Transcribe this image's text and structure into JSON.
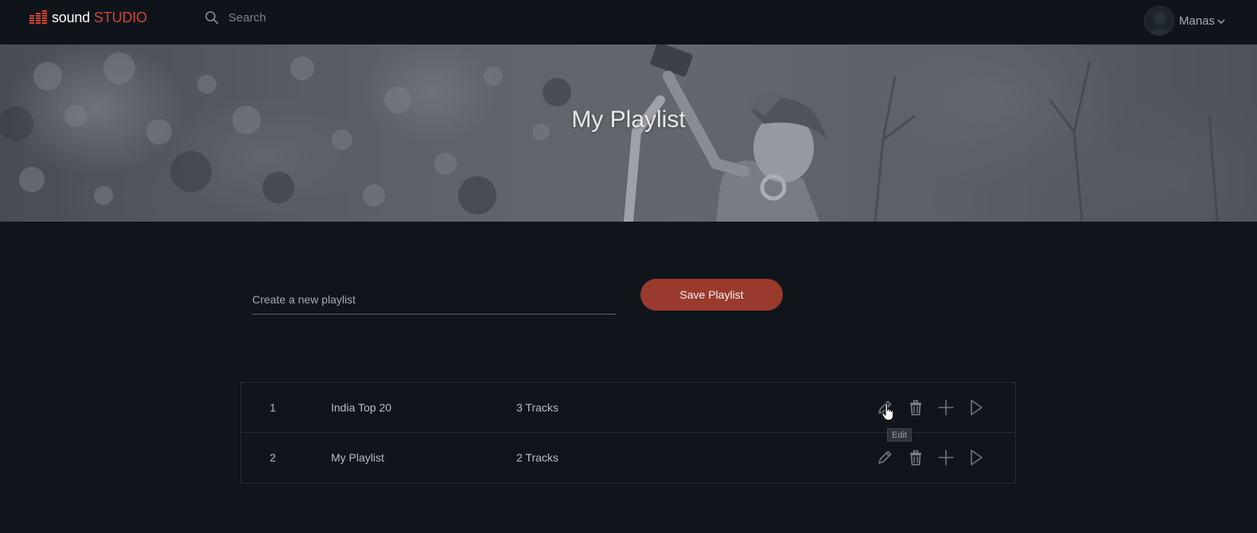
{
  "header": {
    "logo": {
      "word1": "sound",
      "word2": "STUDIO",
      "accent": "#d3452f"
    },
    "search": {
      "placeholder": "Search",
      "value": ""
    },
    "user": {
      "name": "Manas"
    }
  },
  "hero": {
    "title": "My Playlist"
  },
  "create_form": {
    "placeholder": "Create a new playlist",
    "value": "",
    "save_label": "Save Playlist",
    "button_color": "#9a3a2d"
  },
  "playlists": [
    {
      "index": "1",
      "name": "India Top 20",
      "tracks": "3 Tracks"
    },
    {
      "index": "2",
      "name": "My Playlist",
      "tracks": "2 Tracks"
    }
  ],
  "row_actions": [
    "pencil-icon",
    "trash-icon",
    "plus-icon",
    "play-icon"
  ],
  "tooltip": {
    "text": "Edit"
  }
}
